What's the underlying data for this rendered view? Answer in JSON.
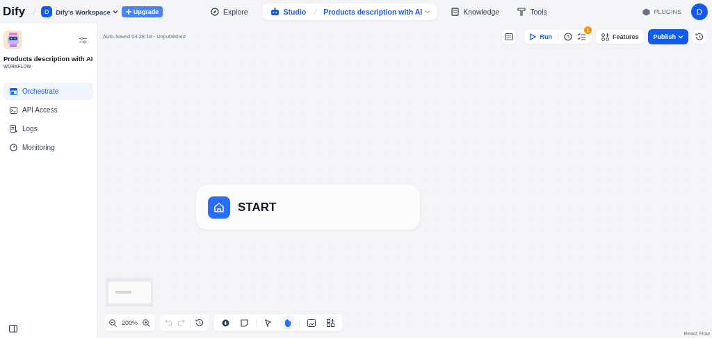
{
  "header": {
    "logo": "Dify",
    "workspace": {
      "avatar": "D",
      "name": "Dify's Workspace"
    },
    "upgrade": "Upgrade",
    "nav": [
      {
        "kind": "explore",
        "label": "Explore",
        "selected": false
      },
      {
        "kind": "studio",
        "label": "Studio",
        "selected": true,
        "breadcrumb": "Products description with AI"
      },
      {
        "kind": "knowledge",
        "label": "Knowledge",
        "selected": false
      },
      {
        "kind": "tools",
        "label": "Tools",
        "selected": false
      }
    ],
    "plugins": "PLUGINS",
    "user_avatar": "D"
  },
  "sidebar": {
    "app_name": "Products description with AI",
    "app_type": "WORKFLOW",
    "items": [
      {
        "kind": "orchestrate",
        "label": "Orchestrate",
        "selected": true
      },
      {
        "kind": "api",
        "label": "API Access",
        "selected": false
      },
      {
        "kind": "logs",
        "label": "Logs",
        "selected": false
      },
      {
        "kind": "monitoring",
        "label": "Monitoring",
        "selected": false
      }
    ]
  },
  "canvas": {
    "status": "Auto-Saved 04:28:18 · Unpublished",
    "run": "Run",
    "checklist_badge": "1",
    "features": "Features",
    "publish": "Publish",
    "node": {
      "title": "START"
    },
    "zoom": "200%",
    "tools": [
      {
        "kind": "add",
        "selected": false
      },
      {
        "kind": "note",
        "selected": false
      },
      {
        "kind": "pointer",
        "selected": false
      },
      {
        "kind": "hand",
        "selected": true
      },
      {
        "kind": "image",
        "selected": false
      },
      {
        "kind": "layout",
        "selected": false
      }
    ],
    "attribution": "React Flow"
  }
}
